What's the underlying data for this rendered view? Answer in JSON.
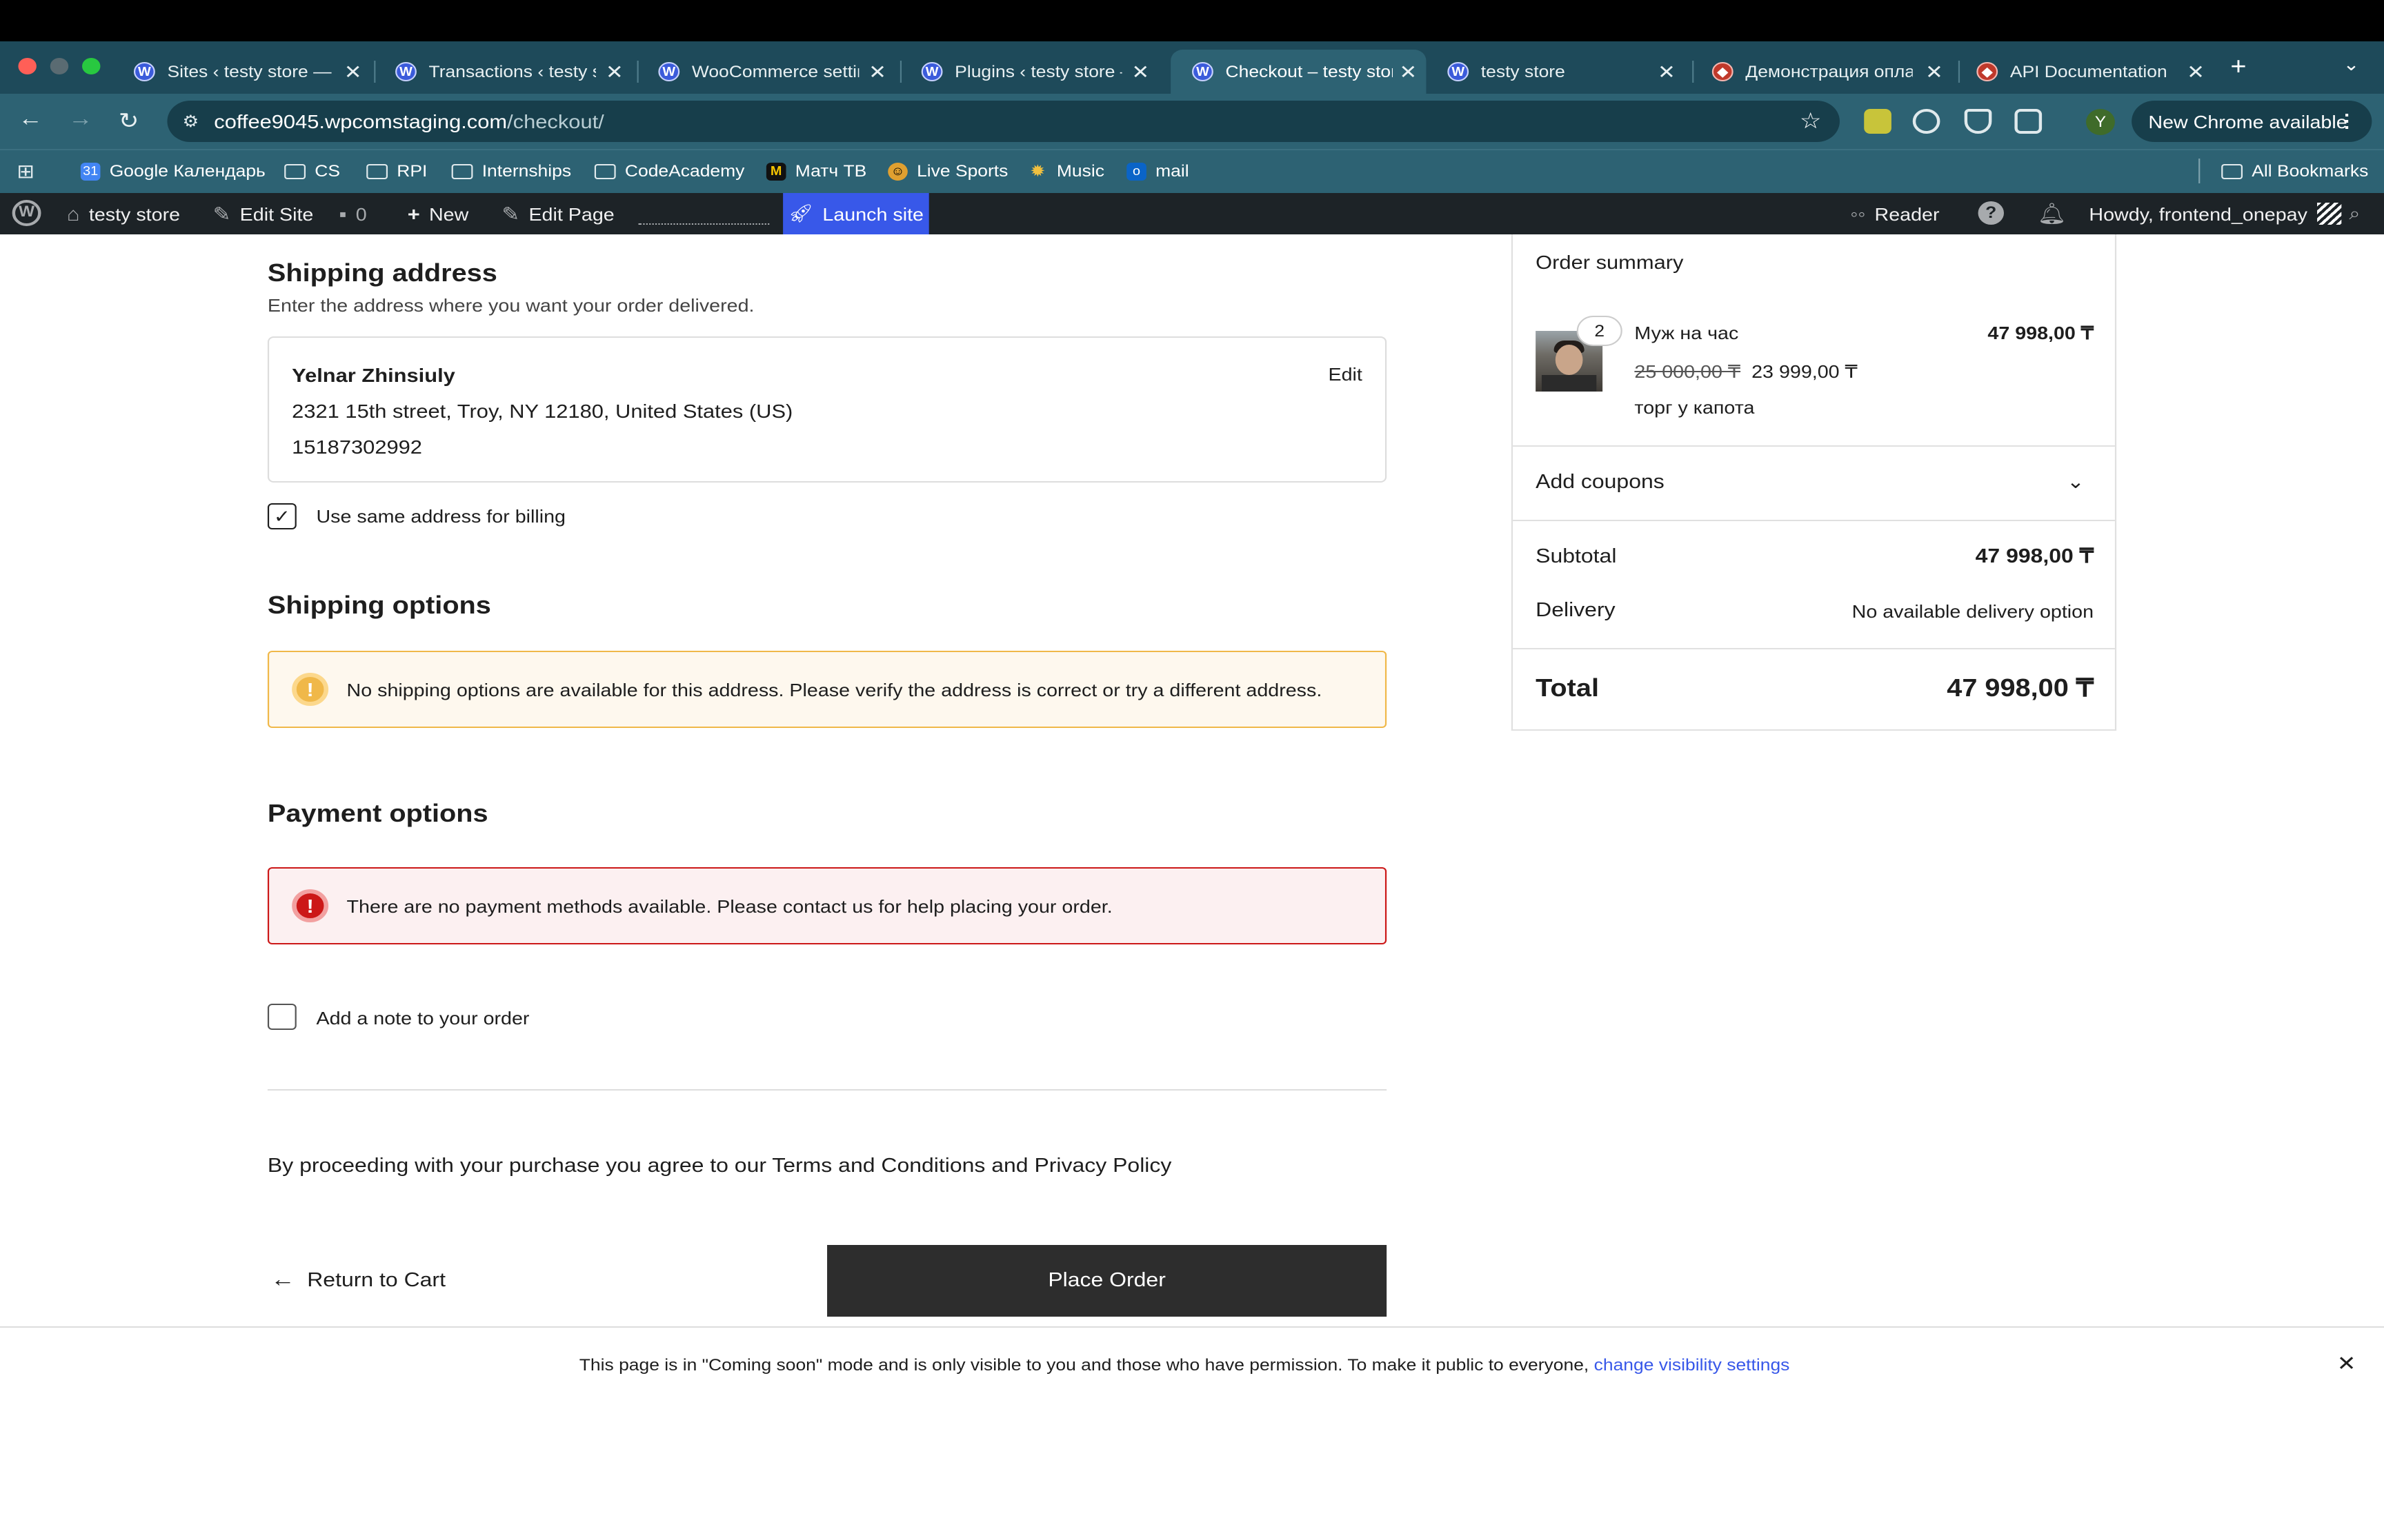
{
  "browser": {
    "tabs": [
      {
        "title": "Sites ‹ testy store — W",
        "icon": "wordpress-icon"
      },
      {
        "title": "Transactions ‹ testy st",
        "icon": "wordpress-icon"
      },
      {
        "title": "WooCommerce settin",
        "icon": "wordpress-icon"
      },
      {
        "title": "Plugins ‹ testy store —",
        "icon": "wordpress-icon"
      },
      {
        "title": "Checkout – testy stor",
        "icon": "wordpress-icon",
        "active": true
      },
      {
        "title": "testy store",
        "icon": "wordpress-icon"
      },
      {
        "title": "Демонстрация опла",
        "icon": "payment-brand-icon"
      },
      {
        "title": "API Documentation",
        "icon": "payment-brand-icon"
      }
    ],
    "new_tab": "+",
    "url_host": "coffee9045.wpcomstaging.com",
    "url_path": "/checkout/",
    "profile_initial": "Y",
    "new_chrome": "New Chrome available",
    "bookmarks": [
      {
        "label": "Google Календарь",
        "icon": "calendar-icon"
      },
      {
        "label": "CS",
        "icon": "folder-icon"
      },
      {
        "label": "RPI",
        "icon": "folder-icon"
      },
      {
        "label": "Internships",
        "icon": "folder-icon"
      },
      {
        "label": "CodeAcademy",
        "icon": "folder-icon"
      },
      {
        "label": "Матч ТВ",
        "icon": "match-tv-icon"
      },
      {
        "label": "Live Sports",
        "icon": "sports-icon"
      },
      {
        "label": "Music",
        "icon": "music-icon"
      },
      {
        "label": "mail",
        "icon": "outlook-icon"
      }
    ],
    "all_bookmarks": "All Bookmarks"
  },
  "wp_admin_bar": {
    "site_name": "testy store",
    "edit_site": "Edit Site",
    "comments_count": "0",
    "new": "New",
    "edit_page": "Edit Page",
    "launch_site": "Launch site",
    "reader": "Reader",
    "howdy": "Howdy, frontend_onepay"
  },
  "checkout": {
    "shipping_address": {
      "title": "Shipping address",
      "subtitle": "Enter the address where you want your order delivered.",
      "name": "Yelnar Zhinsiuly",
      "address_line": "2321 15th street, Troy, NY 12180, United States (US)",
      "phone": "15187302992",
      "edit": "Edit",
      "same_billing_label": "Use same address for billing",
      "same_billing_checked": true
    },
    "shipping_options": {
      "title": "Shipping options",
      "notice": "No shipping options are available for this address. Please verify the address is correct or try a different address."
    },
    "payment_options": {
      "title": "Payment options",
      "notice": "There are no payment methods available. Please contact us for help placing your order."
    },
    "note_label": "Add a note to your order",
    "terms": "By proceeding with your purchase you agree to our Terms and Conditions and Privacy Policy",
    "return_label": "Return to Cart",
    "place_order": "Place Order"
  },
  "order_summary": {
    "title": "Order summary",
    "item": {
      "quantity": "2",
      "name": "Муж на час",
      "line_total": "47 998,00 ₸",
      "regular_price": "25 000,00 ₸",
      "sale_price": "23 999,00 ₸",
      "description": "торг у капота"
    },
    "coupons_label": "Add coupons",
    "subtotal_label": "Subtotal",
    "subtotal_value": "47 998,00 ₸",
    "delivery_label": "Delivery",
    "delivery_value": "No available delivery option",
    "total_label": "Total",
    "total_value": "47 998,00 ₸"
  },
  "coming_soon": {
    "text": "This page is in \"Coming soon\" mode and is only visible to you and those who have permission. To make it public to everyone,",
    "link": "change visibility settings"
  },
  "colors": {
    "tabstrip": "#1e4a5a",
    "toolbar": "#2d6273",
    "wp_bar": "#1d2327",
    "launch_accent": "#3858e9",
    "warning": "#f0b849",
    "error": "#cc1818"
  }
}
